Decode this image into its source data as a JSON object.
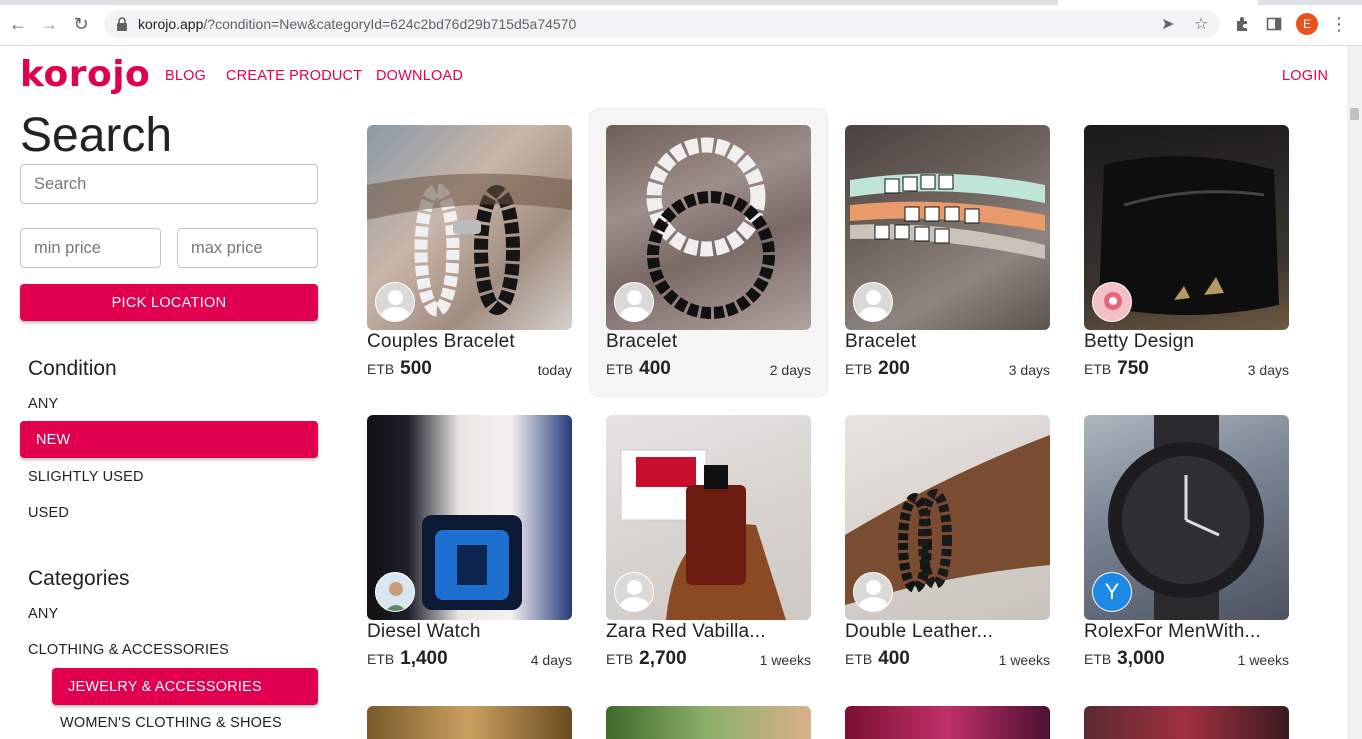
{
  "browser": {
    "url_host": "korojo.app",
    "url_path": "/?condition=New&categoryId=624c2bd76d29b715d5a74570",
    "profile_initial": "E"
  },
  "header": {
    "logo": "korojo",
    "nav": [
      "BLOG",
      "CREATE PRODUCT",
      "DOWNLOAD"
    ],
    "login": "LOGIN"
  },
  "sidebar": {
    "title": "Search",
    "search_placeholder": "Search",
    "min_price_placeholder": "min price",
    "max_price_placeholder": "max price",
    "pick_location": "PICK LOCATION",
    "condition_title": "Condition",
    "conditions": [
      "ANY",
      "NEW",
      "SLIGHTLY USED",
      "USED"
    ],
    "condition_selected": "NEW",
    "categories_title": "Categories",
    "categories": [
      "ANY",
      "CLOTHING & ACCESSORIES",
      "JEWELRY & ACCESSORIES",
      "WOMEN'S CLOTHING & SHOES"
    ],
    "category_selected": "JEWELRY & ACCESSORIES"
  },
  "products": [
    {
      "title": "Couples Bracelet",
      "currency": "ETB",
      "price": "500",
      "age": "today"
    },
    {
      "title": "Bracelet",
      "currency": "ETB",
      "price": "400",
      "age": "2 days"
    },
    {
      "title": "Bracelet",
      "currency": "ETB",
      "price": "200",
      "age": "3 days"
    },
    {
      "title": "Betty Design",
      "currency": "ETB",
      "price": "750",
      "age": "3 days"
    },
    {
      "title": "Diesel Watch",
      "currency": "ETB",
      "price": "1,400",
      "age": "4 days"
    },
    {
      "title": "Zara Red Vabilla...",
      "currency": "ETB",
      "price": "2,700",
      "age": "1 weeks"
    },
    {
      "title": "Double Leather...",
      "currency": "ETB",
      "price": "400",
      "age": "1 weeks"
    },
    {
      "title": "RolexFor MenWith...",
      "currency": "ETB",
      "price": "3,000",
      "age": "1 weeks"
    }
  ],
  "avatar_letter": "Y",
  "colors": {
    "brand": "#e0004d"
  }
}
